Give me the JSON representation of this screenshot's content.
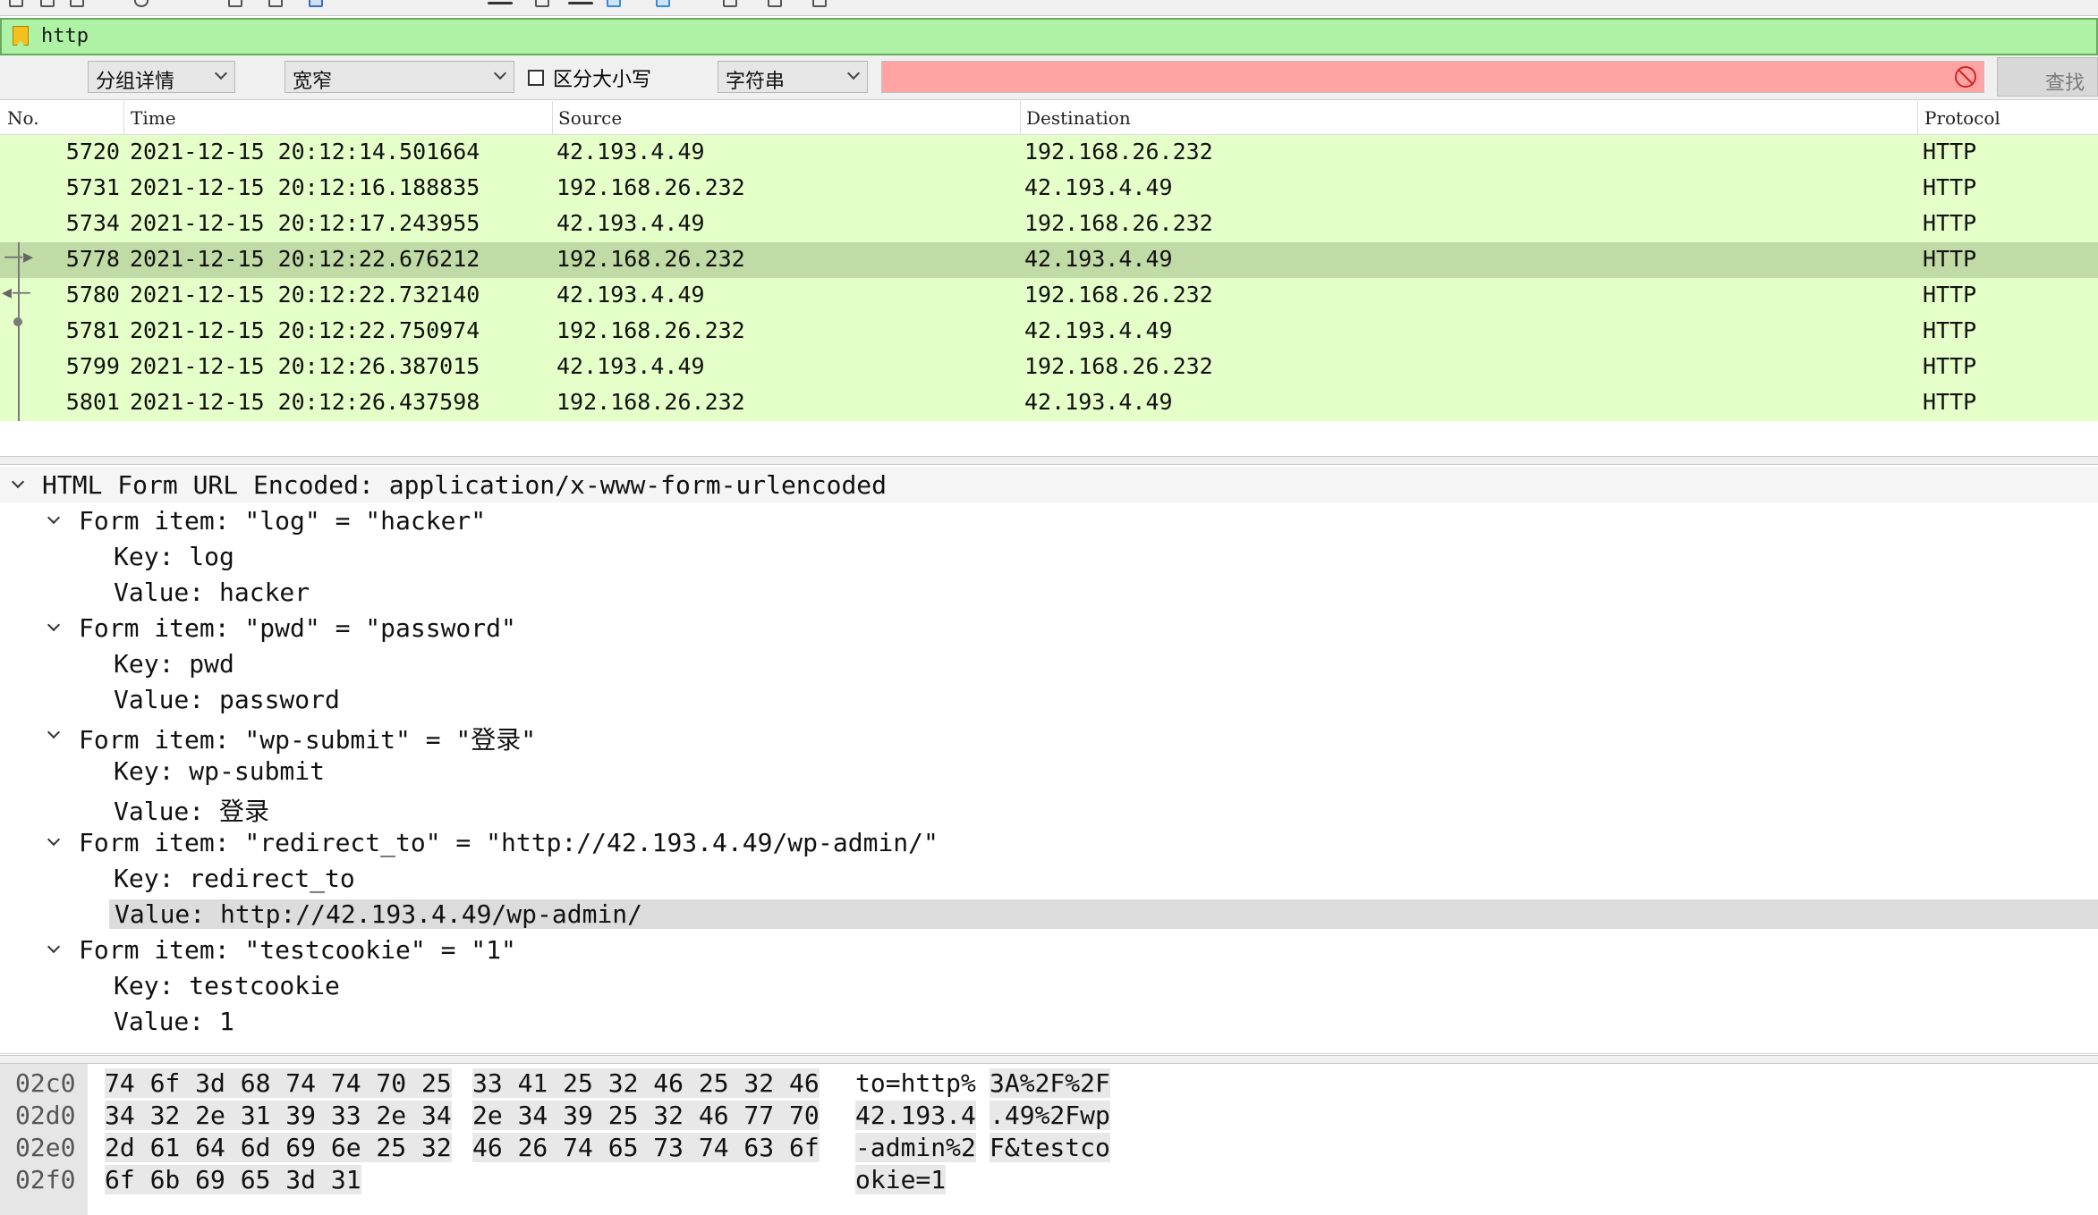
{
  "filter": {
    "value": "http"
  },
  "findbar": {
    "search_in": "分组详情",
    "char_width": "宽窄",
    "case_sensitive_label": "区分大小写",
    "search_type": "字符串",
    "search_value": "",
    "find_label": "查找"
  },
  "packet_list": {
    "columns": [
      "No.",
      "Time",
      "Source",
      "Destination",
      "Protocol"
    ],
    "rows": [
      {
        "no": "5720",
        "time": "2021-12-15 20:12:14.501664",
        "source": "42.193.4.49",
        "destination": "192.168.26.232",
        "protocol": "HTTP"
      },
      {
        "no": "5731",
        "time": "2021-12-15 20:12:16.188835",
        "source": "192.168.26.232",
        "destination": "42.193.4.49",
        "protocol": "HTTP"
      },
      {
        "no": "5734",
        "time": "2021-12-15 20:12:17.243955",
        "source": "42.193.4.49",
        "destination": "192.168.26.232",
        "protocol": "HTTP"
      },
      {
        "no": "5778",
        "time": "2021-12-15 20:12:22.676212",
        "source": "192.168.26.232",
        "destination": "42.193.4.49",
        "protocol": "HTTP",
        "selected": true
      },
      {
        "no": "5780",
        "time": "2021-12-15 20:12:22.732140",
        "source": "42.193.4.49",
        "destination": "192.168.26.232",
        "protocol": "HTTP"
      },
      {
        "no": "5781",
        "time": "2021-12-15 20:12:22.750974",
        "source": "192.168.26.232",
        "destination": "42.193.4.49",
        "protocol": "HTTP"
      },
      {
        "no": "5799",
        "time": "2021-12-15 20:12:26.387015",
        "source": "42.193.4.49",
        "destination": "192.168.26.232",
        "protocol": "HTTP"
      },
      {
        "no": "5801",
        "time": "2021-12-15 20:12:26.437598",
        "source": "192.168.26.232",
        "destination": "42.193.4.49",
        "protocol": "HTTP"
      }
    ],
    "scroll_left_glyph": "‹"
  },
  "details": {
    "root": "HTML Form URL Encoded: application/x-www-form-urlencoded",
    "items": [
      {
        "header": "Form item: \"log\" = \"hacker\"",
        "key": "Key: log",
        "value": "Value: hacker"
      },
      {
        "header": "Form item: \"pwd\" = \"password\"",
        "key": "Key: pwd",
        "value": "Value: password"
      },
      {
        "header": "Form item: \"wp-submit\" = \"登录\"",
        "key": "Key: wp-submit",
        "value": "Value: 登录"
      },
      {
        "header": "Form item: \"redirect_to\" = \"http://42.193.4.49/wp-admin/\"",
        "key": "Key: redirect_to",
        "value": "Value: http://42.193.4.49/wp-admin/",
        "value_highlighted": true
      },
      {
        "header": "Form item: \"testcookie\" = \"1\"",
        "key": "Key: testcookie",
        "value": "Value: 1"
      }
    ]
  },
  "hex": {
    "rows": [
      {
        "offset": "02c0",
        "bytes1": "74 6f 3d 68 74 74 70 25",
        "bytes2": "33 41 25 32 46 25 32 46",
        "ascii1": "to=http%",
        "ascii2": "3A%2F%2F"
      },
      {
        "offset": "02d0",
        "bytes1": "34 32 2e 31 39 33 2e 34",
        "bytes2": "2e 34 39 25 32 46 77 70",
        "ascii1": "42.193.4",
        "ascii2": ".49%2Fwp"
      },
      {
        "offset": "02e0",
        "bytes1": "2d 61 64 6d 69 6e 25 32",
        "bytes2": "46 26 74 65 73 74 63 6f",
        "ascii1": "-admin%2",
        "ascii2": "F&testco"
      },
      {
        "offset": "02f0",
        "bytes1": "6f 6b 69 65 3d 31",
        "bytes2": "",
        "ascii1": "okie=1",
        "ascii2": ""
      }
    ]
  },
  "colors": {
    "filter_valid_bg": "#aef2a6",
    "row_bg": "#e4ffc7",
    "row_selected_bg": "#c0dba5",
    "search_error_bg": "#ffa3a3"
  }
}
